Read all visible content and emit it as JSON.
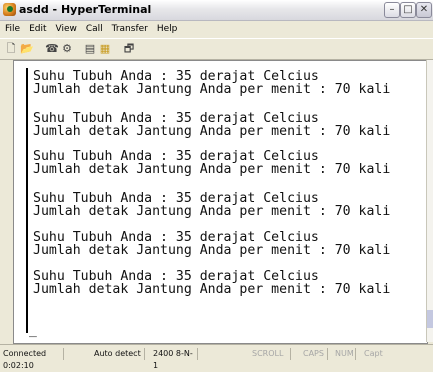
{
  "window": {
    "title": "asdd - HyperTerminal",
    "buttons": [
      "minimize",
      "maximize",
      "close"
    ]
  },
  "menu": [
    "File",
    "Edit",
    "View",
    "Call",
    "Transfer",
    "Help"
  ],
  "toolbar_icons": [
    "new-icon",
    "open-icon",
    "disconnect-icon",
    "properties-icon",
    "send-icon",
    "receive-icon",
    "settings-icon"
  ],
  "terminal": {
    "lines": [
      "Suhu Tubuh Anda : 35 derajat Celcius",
      "Jumlah detak Jantung Anda per menit : 70 kali",
      "Suhu Tubuh Anda : 35 derajat Celcius",
      "Jumlah detak Jantung Anda per menit : 70 kali",
      "Suhu Tubuh Anda : 35 derajat Celcius",
      "Jumlah detak Jantung Anda per menit : 70 kali",
      "Suhu Tubuh Anda : 35 derajat Celcius",
      "Jumlah detak Jantung Anda per menit : 70 kali",
      "Suhu Tubuh Anda : 35 derajat Celcius",
      "Jumlah detak Jantung Anda per menit : 70 kali",
      "Suhu Tubuh Anda : 35 derajat Celcius",
      "Jumlah detak Jantung Anda per menit : 70 kali"
    ],
    "cursor": "_"
  },
  "status": {
    "connected": "Connected 0:02:10",
    "detect": "Auto detect",
    "settings": "2400 8-N-1",
    "scroll": "SCROLL",
    "caps": "CAPS",
    "num": "NUM",
    "capture": "Capt"
  }
}
